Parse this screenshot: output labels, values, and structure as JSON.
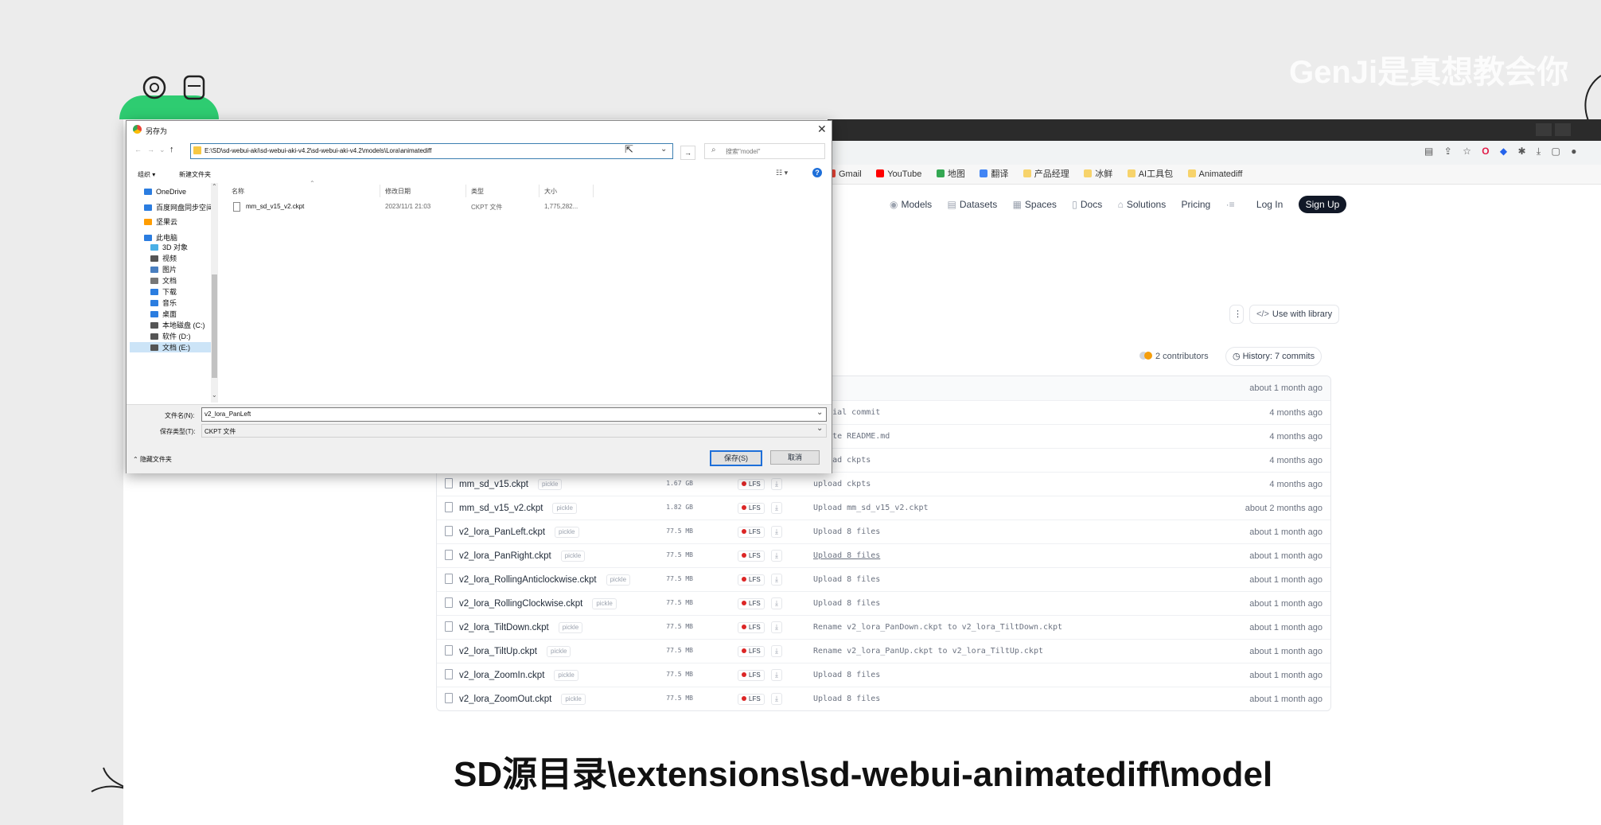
{
  "watermark": "GenJi是真想教会你",
  "caption": "SD源目录\\extensions\\sd-webui-animatediff\\model",
  "browser": {
    "bookmarks": [
      "Gmail",
      "YouTube",
      "地图",
      "翻译",
      "产品经理",
      "冰鲜",
      "AI工具包",
      "Animatediff"
    ],
    "nav": {
      "models": "Models",
      "datasets": "Datasets",
      "spaces": "Spaces",
      "docs": "Docs",
      "solutions": "Solutions",
      "pricing": "Pricing",
      "login": "Log In",
      "signup": "Sign Up"
    },
    "use_with_library": "Use with library",
    "contributors": "2 contributors",
    "history": "History: 7 commits",
    "latest_commit_time": "about 1 month ago"
  },
  "files": [
    {
      "name": "",
      "size": "",
      "message": "Initial commit",
      "date": "4 months ago",
      "partial": true
    },
    {
      "name": "",
      "size": "",
      "message": "Update README.md",
      "date": "4 months ago",
      "partial": true
    },
    {
      "name": "",
      "size": "",
      "message": "Upload ckpts",
      "date": "4 months ago",
      "partial": true
    },
    {
      "name": "mm_sd_v15.ckpt",
      "pickle": "pickle",
      "size": "1.67 GB",
      "lfs": "LFS",
      "message": "upload ckpts",
      "date": "4 months ago"
    },
    {
      "name": "mm_sd_v15_v2.ckpt",
      "pickle": "pickle",
      "size": "1.82 GB",
      "lfs": "LFS",
      "message": "Upload mm_sd_v15_v2.ckpt",
      "date": "about 2 months ago"
    },
    {
      "name": "v2_lora_PanLeft.ckpt",
      "pickle": "pickle",
      "size": "77.5 MB",
      "lfs": "LFS",
      "message": "Upload 8 files",
      "date": "about 1 month ago"
    },
    {
      "name": "v2_lora_PanRight.ckpt",
      "pickle": "pickle",
      "size": "77.5 MB",
      "lfs": "LFS",
      "message": "Upload 8 files",
      "date": "about 1 month ago",
      "underline": true
    },
    {
      "name": "v2_lora_RollingAnticlockwise.ckpt",
      "pickle": "pickle",
      "size": "77.5 MB",
      "lfs": "LFS",
      "message": "Upload 8 files",
      "date": "about 1 month ago"
    },
    {
      "name": "v2_lora_RollingClockwise.ckpt",
      "pickle": "pickle",
      "size": "77.5 MB",
      "lfs": "LFS",
      "message": "Upload 8 files",
      "date": "about 1 month ago"
    },
    {
      "name": "v2_lora_TiltDown.ckpt",
      "pickle": "pickle",
      "size": "77.5 MB",
      "lfs": "LFS",
      "message": "Rename v2_lora_PanDown.ckpt to v2_lora_TiltDown.ckpt",
      "date": "about 1 month ago"
    },
    {
      "name": "v2_lora_TiltUp.ckpt",
      "pickle": "pickle",
      "size": "77.5 MB",
      "lfs": "LFS",
      "message": "Rename v2_lora_PanUp.ckpt to v2_lora_TiltUp.ckpt",
      "date": "about 1 month ago"
    },
    {
      "name": "v2_lora_ZoomIn.ckpt",
      "pickle": "pickle",
      "size": "77.5 MB",
      "lfs": "LFS",
      "message": "Upload 8 files",
      "date": "about 1 month ago"
    },
    {
      "name": "v2_lora_ZoomOut.ckpt",
      "pickle": "pickle",
      "size": "77.5 MB",
      "lfs": "LFS",
      "message": "Upload 8 files",
      "date": "about 1 month ago"
    }
  ],
  "dialog": {
    "title": "另存为",
    "address": "E:\\SD\\sd-webui-aki\\sd-webui-aki-v4.2\\sd-webui-aki-v4.2\\models\\Lora\\animatediff",
    "search_placeholder": "搜索\"model\"",
    "organize": "组织 ▾",
    "new_folder": "新建文件夹",
    "columns": {
      "name": "名称",
      "modified": "修改日期",
      "type": "类型",
      "size": "大小"
    },
    "nav_items": [
      "OneDrive",
      "百度网盘同步空间",
      "坚果云",
      "此电脑",
      "3D 对象",
      "视频",
      "图片",
      "文档",
      "下载",
      "音乐",
      "桌面",
      "本地磁盘 (C:)",
      "软件 (D:)",
      "文档 (E:)"
    ],
    "file": {
      "name": "mm_sd_v15_v2.ckpt",
      "modified": "2023/11/1 21:03",
      "type": "CKPT 文件",
      "size": "1,775,282..."
    },
    "filename_label": "文件名(N):",
    "filename_value": "v2_lora_PanLeft",
    "filetype_label": "保存类型(T):",
    "filetype_value": "CKPT 文件",
    "hide_folders": "隐藏文件夹",
    "save": "保存(S)",
    "cancel": "取消"
  },
  "colors": {
    "accent": "#3c7fb1",
    "lfs_red": "#dc2626",
    "signup_bg": "#111827"
  }
}
